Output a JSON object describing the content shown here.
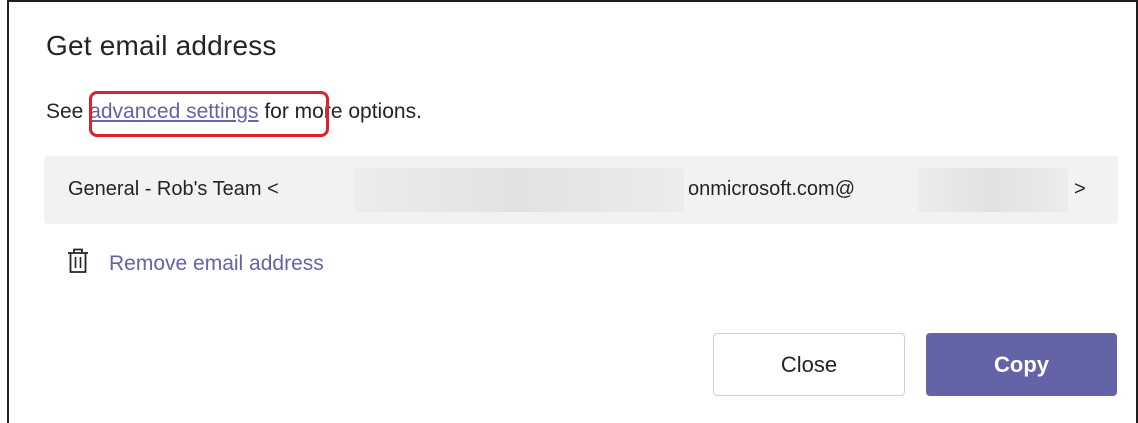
{
  "dialog": {
    "title": "Get email address",
    "description": {
      "prefix": "See ",
      "link_label": "advanced settings",
      "suffix": " for more options."
    },
    "email": {
      "part1": "General - Rob's Team <",
      "part2": "onmicrosoft.com@",
      "part3": ">"
    },
    "remove_label": "Remove email address",
    "buttons": {
      "close_label": "Close",
      "copy_label": "Copy"
    }
  },
  "colors": {
    "accent": "#6264a7",
    "highlight": "#e0202a",
    "email_box_bg": "#f3f2f1",
    "text": "#252423"
  },
  "icons": {
    "remove": "trash-icon"
  }
}
